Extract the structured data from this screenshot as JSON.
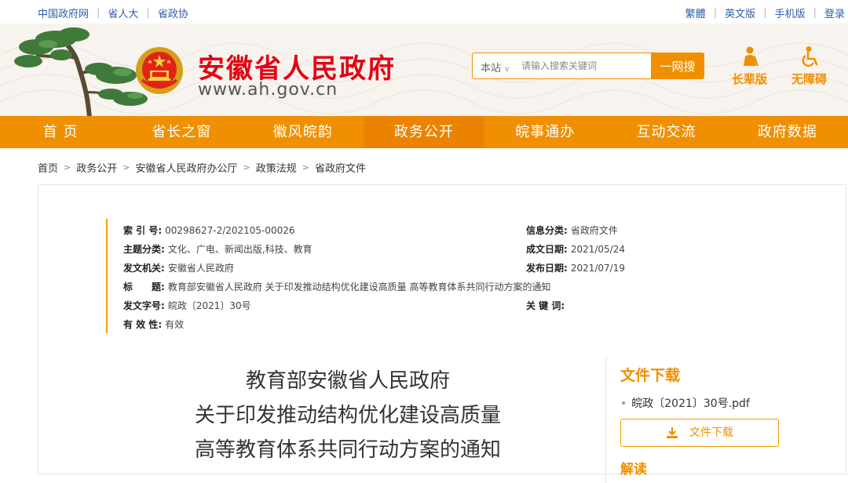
{
  "top_links_left": [
    "中国政府网",
    "省人大",
    "省政协"
  ],
  "top_links_right": [
    "繁體",
    "英文版",
    "手机版",
    "登录"
  ],
  "site": {
    "title": "安徽省人民政府",
    "url": "www.ah.gov.cn"
  },
  "search": {
    "scope": "本站",
    "placeholder": "请输入搜索关键词",
    "button": "一网搜"
  },
  "tools": {
    "elder": "长辈版",
    "accessible": "无障碍"
  },
  "nav": [
    {
      "label": "首 页"
    },
    {
      "label": "省长之窗"
    },
    {
      "label": "徽风皖韵"
    },
    {
      "label": "政务公开",
      "active": true
    },
    {
      "label": "皖事通办"
    },
    {
      "label": "互动交流"
    },
    {
      "label": "政府数据"
    }
  ],
  "breadcrumb": [
    "首页",
    "政务公开",
    "安徽省人民政府办公厅",
    "政策法规",
    "省政府文件"
  ],
  "meta": {
    "index_label": "索 引 号:",
    "index_value": "00298627-2/202105-00026",
    "category_label": "信息分类:",
    "category_value": "省政府文件",
    "topic_label": "主题分类:",
    "topic_value": "文化、广电、新闻出版,科技、教育",
    "created_label": "成文日期:",
    "created_value": "2021/05/24",
    "issuer_label": "发文机关:",
    "issuer_value": "安徽省人民政府",
    "published_label": "发布日期:",
    "published_value": "2021/07/19",
    "title_label": "标　　题:",
    "title_value": "教育部安徽省人民政府 关于印发推动结构优化建设高质量 高等教育体系共同行动方案的通知",
    "docno_label": "发文字号:",
    "docno_value": "皖政〔2021〕30号",
    "keywords_label": "关 键 词:",
    "keywords_value": "",
    "validity_label": "有 效 性:",
    "validity_value": "有效"
  },
  "document": {
    "title_lines": [
      "教育部安徽省人民政府",
      "关于印发推动结构优化建设高质量",
      "高等教育体系共同行动方案的通知"
    ]
  },
  "sidebar": {
    "download_heading": "文件下载",
    "file_name": "皖政〔2021〕30号.pdf",
    "download_button": "文件下载",
    "next_heading": "解读"
  },
  "colors": {
    "accent": "#f08f00",
    "title_red": "#e60012",
    "link_blue": "#2d5ea8"
  }
}
